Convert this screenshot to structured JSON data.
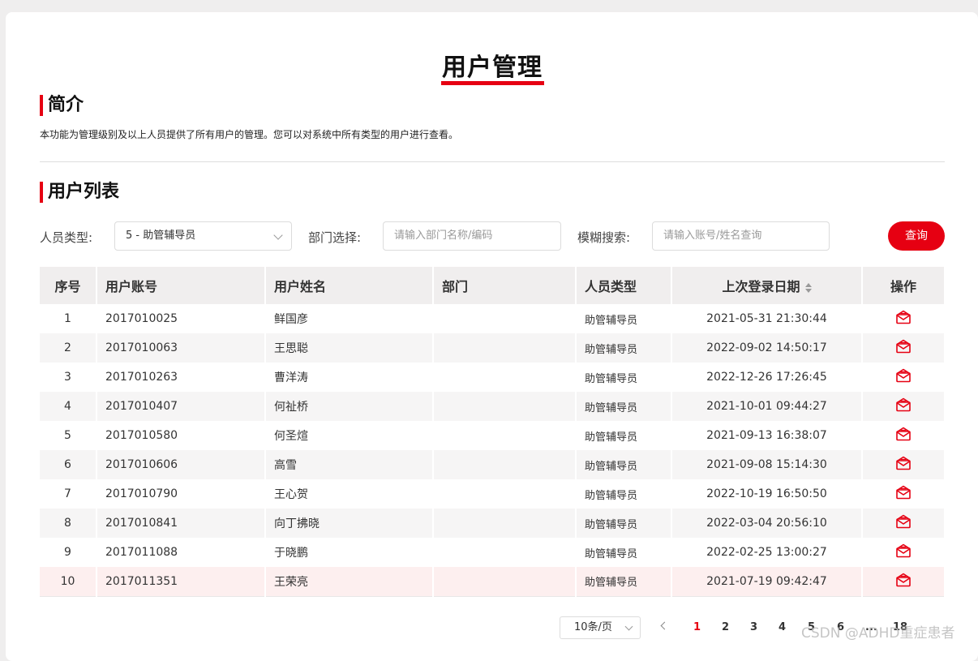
{
  "page": {
    "title": "用户管理"
  },
  "intro": {
    "heading": "简介",
    "text": "本功能为管理级别及以上人员提供了所有用户的管理。您可以对系统中所有类型的用户进行查看。"
  },
  "list": {
    "heading": "用户列表"
  },
  "filters": {
    "type_label": "人员类型:",
    "type_value": "5 -  助管辅导员",
    "dept_label": "部门选择:",
    "dept_placeholder": "请输入部门名称/编码",
    "search_label": "模糊搜索:",
    "search_placeholder": "请输入账号/姓名查询",
    "query_button": "查询"
  },
  "table": {
    "headers": {
      "index": "序号",
      "account": "用户账号",
      "name": "用户姓名",
      "dept": "部门",
      "type": "人员类型",
      "last_login": "上次登录日期",
      "action": "操作"
    },
    "rows": [
      {
        "index": "1",
        "account": "2017010025",
        "name": "鲜国彦",
        "dept": "",
        "type": "助管辅导员",
        "last_login": "2021-05-31 21:30:44"
      },
      {
        "index": "2",
        "account": "2017010063",
        "name": "王思聪",
        "dept": "",
        "type": "助管辅导员",
        "last_login": "2022-09-02 14:50:17"
      },
      {
        "index": "3",
        "account": "2017010263",
        "name": "曹洋涛",
        "dept": "",
        "type": "助管辅导员",
        "last_login": "2022-12-26 17:26:45"
      },
      {
        "index": "4",
        "account": "2017010407",
        "name": "何祉桥",
        "dept": "",
        "type": "助管辅导员",
        "last_login": "2021-10-01 09:44:27"
      },
      {
        "index": "5",
        "account": "2017010580",
        "name": "何圣煊",
        "dept": "",
        "type": "助管辅导员",
        "last_login": "2021-09-13 16:38:07"
      },
      {
        "index": "6",
        "account": "2017010606",
        "name": "高雪",
        "dept": "",
        "type": "助管辅导员",
        "last_login": "2021-09-08 15:14:30"
      },
      {
        "index": "7",
        "account": "2017010790",
        "name": "王心贺",
        "dept": "",
        "type": "助管辅导员",
        "last_login": "2022-10-19 16:50:50"
      },
      {
        "index": "8",
        "account": "2017010841",
        "name": "向丁拂晓",
        "dept": "",
        "type": "助管辅导员",
        "last_login": "2022-03-04 20:56:10"
      },
      {
        "index": "9",
        "account": "2017011088",
        "name": "于晓鹏",
        "dept": "",
        "type": "助管辅导员",
        "last_login": "2022-02-25 13:00:27"
      },
      {
        "index": "10",
        "account": "2017011351",
        "name": "王荣亮",
        "dept": "",
        "type": "助管辅导员",
        "last_login": "2021-07-19 09:42:47"
      }
    ]
  },
  "pagination": {
    "page_size": "10条/页",
    "pages": [
      "1",
      "2",
      "3",
      "4",
      "5",
      "6",
      "...",
      "18"
    ],
    "current": "1"
  },
  "watermark": "CSDN @ADHD重症患者",
  "colors": {
    "accent": "#e60012",
    "header_bg": "#f0eeee",
    "stripe": "#f6f5f5",
    "highlight": "#fdefef"
  },
  "icons": {
    "action": "mail-open-icon",
    "sort": "sort-icon",
    "dropdown": "chevron-down-icon",
    "prev": "chevron-left-icon"
  }
}
